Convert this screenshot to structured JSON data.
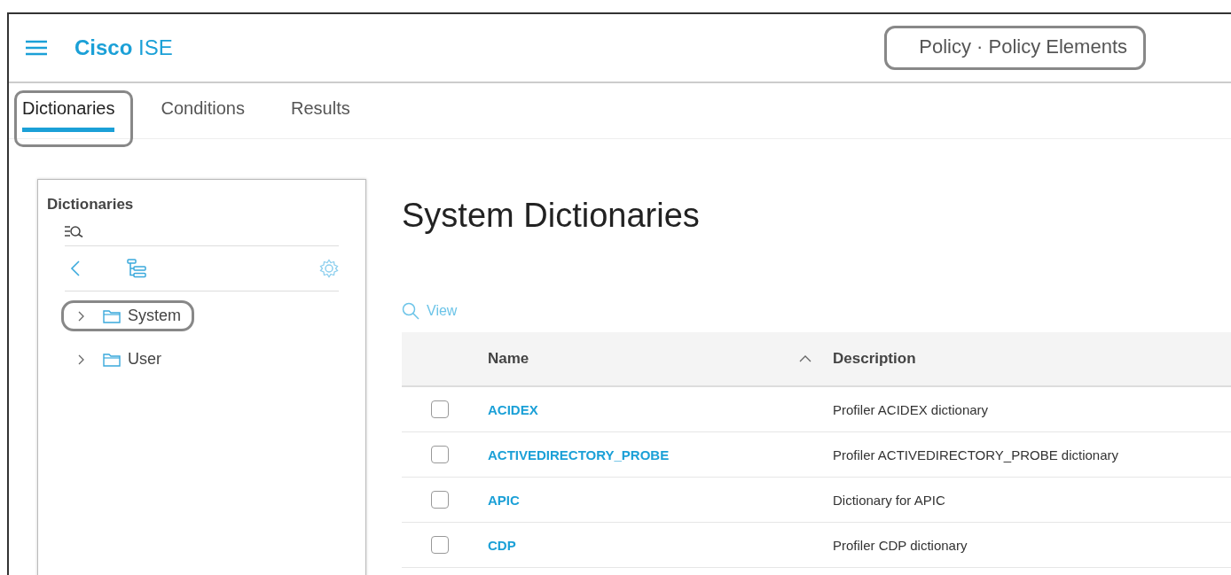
{
  "header": {
    "brand_bold": "Cisco",
    "brand_light": "ISE",
    "breadcrumb": "Policy · Policy Elements",
    "breadcrumb_highlighted": true
  },
  "tabs": [
    {
      "label": "Dictionaries",
      "selected": true,
      "highlighted": true
    },
    {
      "label": "Conditions",
      "selected": false,
      "highlighted": false
    },
    {
      "label": "Results",
      "selected": false,
      "highlighted": false
    }
  ],
  "sidebar": {
    "title": "Dictionaries",
    "tree": [
      {
        "label": "System",
        "expanded": false,
        "highlighted": true
      },
      {
        "label": "User",
        "expanded": false,
        "highlighted": false
      }
    ]
  },
  "main": {
    "title": "System Dictionaries",
    "view_action": "View",
    "table": {
      "columns": [
        {
          "label": "Name",
          "sorted_ascending": true
        },
        {
          "label": "Description"
        }
      ],
      "rows": [
        {
          "name": "ACIDEX",
          "description": "Profiler ACIDEX dictionary",
          "checked": false
        },
        {
          "name": "ACTIVEDIRECTORY_PROBE",
          "description": "Profiler ACTIVEDIRECTORY_PROBE dictionary",
          "checked": false
        },
        {
          "name": "APIC",
          "description": "Dictionary for APIC",
          "checked": false
        },
        {
          "name": "CDP",
          "description": "Profiler CDP dictionary",
          "checked": false
        }
      ]
    }
  }
}
